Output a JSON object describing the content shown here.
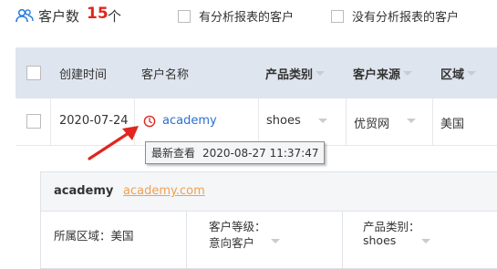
{
  "header": {
    "count_label": "客户数",
    "count_value": "15",
    "count_unit": "个",
    "filter_with_report": "有分析报表的客户",
    "filter_without_report": "没有分析报表的客户"
  },
  "table": {
    "columns": {
      "created": "创建时间",
      "name": "客户名称",
      "category": "产品类别",
      "source": "客户来源",
      "region": "区域"
    },
    "row": {
      "created": "2020-07-24",
      "name": "academy",
      "category": "shoes",
      "source": "优贸网",
      "region": "美国"
    }
  },
  "tooltip": {
    "label": "最新查看",
    "timestamp": "2020-08-27 11:37:47"
  },
  "detail": {
    "name": "academy",
    "website": "academy.com",
    "region_text": "所属区域：美国",
    "level_label": "客户等级：",
    "level_value": "意向客户",
    "category_label": "产品类别：",
    "category_value": "shoes"
  },
  "colors": {
    "accent_red": "#e0261f",
    "link_blue": "#2a6fd1",
    "link_orange": "#f0a050",
    "header_bg": "#dfe5ee"
  },
  "icons": {
    "user": "users-icon",
    "recent": "clock-icon",
    "pointer": "red-arrow-annotation"
  }
}
